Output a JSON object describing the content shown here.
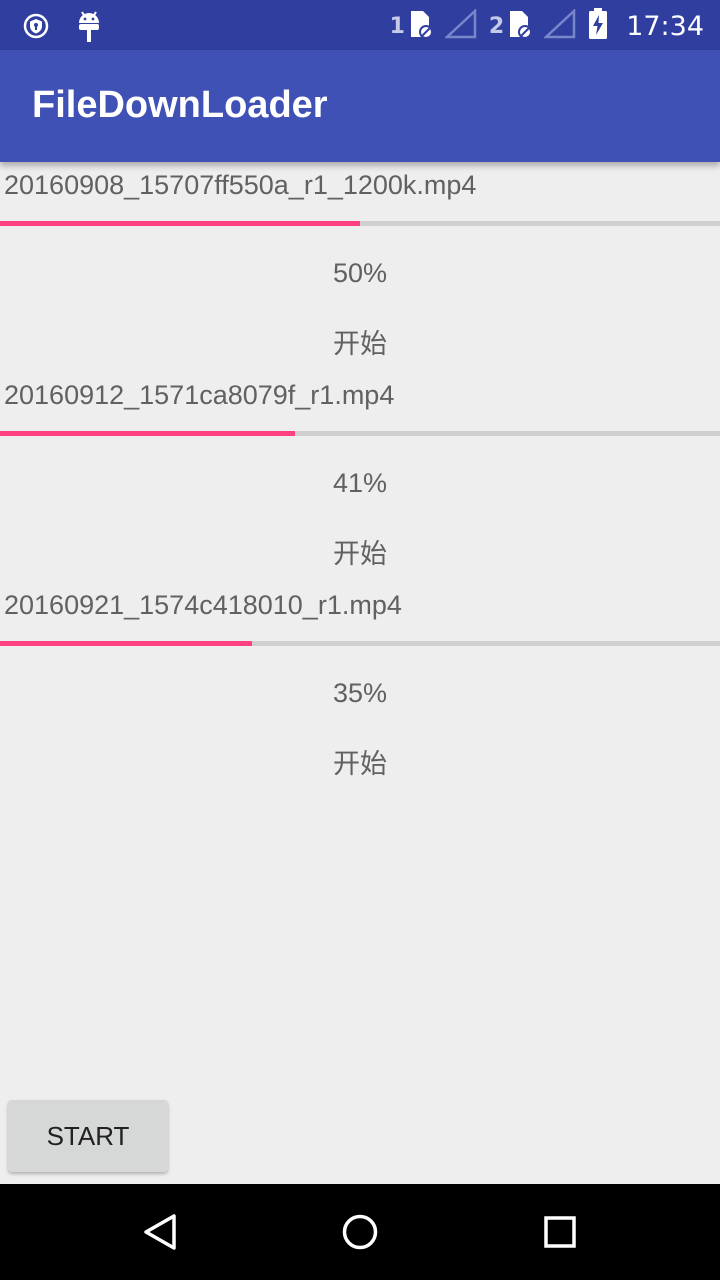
{
  "status_bar": {
    "time": "17:34",
    "sim1_label": "1",
    "sim2_label": "2",
    "icons": [
      "shield-icon",
      "android-debug-icon",
      "sim-card-icon",
      "signal-icon",
      "battery-charging-icon"
    ]
  },
  "app_bar": {
    "title": "FileDownLoader"
  },
  "downloads": [
    {
      "filename": "20160908_15707ff550a_r1_1200k.mp4",
      "progress": 50,
      "percent_label": "50%",
      "action_label": "开始"
    },
    {
      "filename": "20160912_1571ca8079f_r1.mp4",
      "progress": 41,
      "percent_label": "41%",
      "action_label": "开始"
    },
    {
      "filename": "20160921_1574c418010_r1.mp4",
      "progress": 35,
      "percent_label": "35%",
      "action_label": "开始"
    }
  ],
  "start_button": {
    "label": "START"
  },
  "nav_bar": {
    "icons": [
      "back-icon",
      "home-icon",
      "recents-icon"
    ]
  },
  "colors": {
    "status_bar": "#303f9f",
    "app_bar": "#3f51b5",
    "accent": "#ff4081",
    "background": "#eeeeee"
  }
}
